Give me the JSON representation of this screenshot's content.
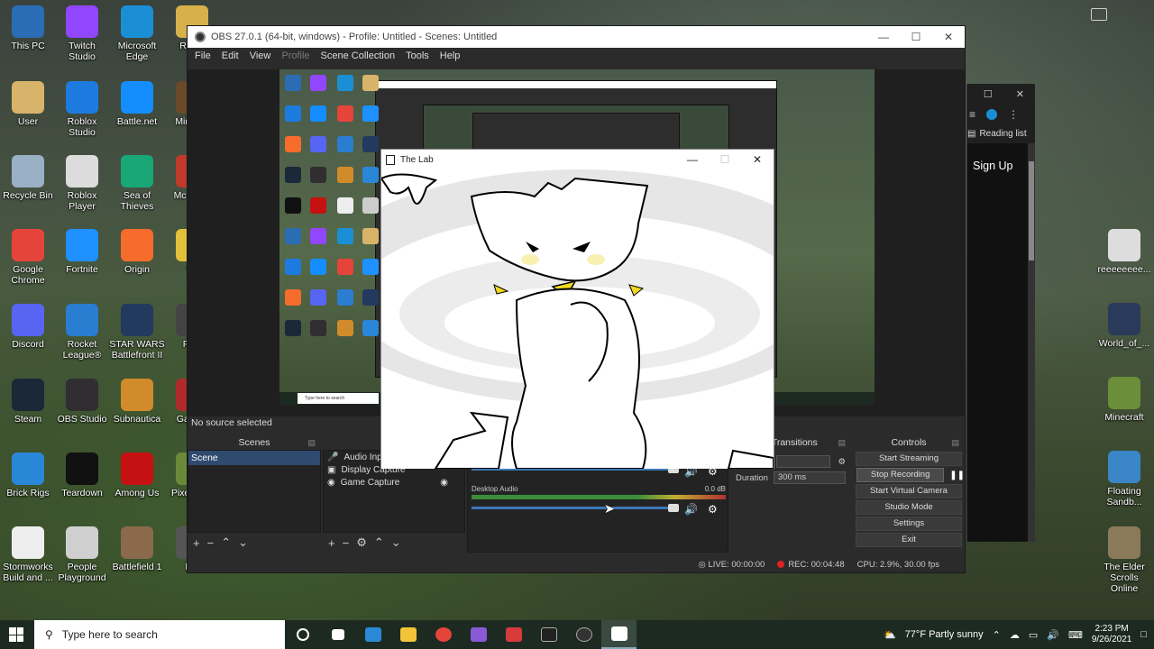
{
  "desktop_icons": [
    {
      "label": "This PC",
      "color": "#2a6db5"
    },
    {
      "label": "Twitch Studio",
      "color": "#9146ff"
    },
    {
      "label": "Microsoft Edge",
      "color": "#1b8fd6"
    },
    {
      "label": "REAL",
      "color": "#d6b04a"
    },
    {
      "label": "User",
      "color": "#d8b36a"
    },
    {
      "label": "Roblox Studio",
      "color": "#1d7be0"
    },
    {
      "label": "Battle.net",
      "color": "#148eff"
    },
    {
      "label": "Min Lau",
      "color": "#6b4a2b"
    },
    {
      "label": "Recycle Bin",
      "color": "#9ab0c4"
    },
    {
      "label": "Roblox Player",
      "color": "#dcdcdc"
    },
    {
      "label": "Sea of Thieves",
      "color": "#1aa777"
    },
    {
      "label": "Mc Secu",
      "color": "#c0392b"
    },
    {
      "label": "Google Chrome",
      "color": "#e5443a"
    },
    {
      "label": "Fortnite",
      "color": "#1e90ff"
    },
    {
      "label": "Origin",
      "color": "#f56c2d"
    },
    {
      "label": "Wi",
      "color": "#e1c03a"
    },
    {
      "label": "Discord",
      "color": "#5865f2"
    },
    {
      "label": "Rocket League®",
      "color": "#2a7dd1"
    },
    {
      "label": "STAR WARS Battlefront II",
      "color": "#223a5e"
    },
    {
      "label": "Play",
      "color": "#444444"
    },
    {
      "label": "Steam",
      "color": "#1b2838"
    },
    {
      "label": "OBS Studio",
      "color": "#302e31"
    },
    {
      "label": "Subnautica",
      "color": "#d18b2a"
    },
    {
      "label": "Gamea",
      "color": "#b02a2a"
    },
    {
      "label": "Brick Rigs",
      "color": "#2a86d6"
    },
    {
      "label": "Teardown",
      "color": "#111111"
    },
    {
      "label": "Among Us",
      "color": "#c51111"
    },
    {
      "label": "Pixel FPS",
      "color": "#6a8a3a"
    },
    {
      "label": "Stormworks Build and ...",
      "color": "#eeeeee"
    },
    {
      "label": "People Playground",
      "color": "#cfcfcf"
    },
    {
      "label": "Battlefield 1",
      "color": "#8a6a4a"
    },
    {
      "label": "Enl",
      "color": "#555555"
    },
    {
      "label": "reeeeeeee...",
      "color": "#dddddd"
    },
    {
      "label": "World_of_...",
      "color": "#2a3a5a"
    },
    {
      "label": "Minecraft",
      "color": "#6b8e3a"
    },
    {
      "label": "Floating Sandb...",
      "color": "#3a86c6"
    },
    {
      "label": "The Elder Scrolls Online",
      "color": "#8a7a5a"
    }
  ],
  "obs": {
    "title": "OBS 27.0.1 (64-bit, windows) - Profile: Untitled - Scenes: Untitled",
    "menu": [
      "File",
      "Edit",
      "View",
      "Profile",
      "Scene Collection",
      "Tools",
      "Help"
    ],
    "source_status": "No source selected",
    "scenes": {
      "header": "Scenes",
      "items": [
        "Scene"
      ]
    },
    "sources": {
      "header": "So",
      "items": [
        "Audio Input",
        "Display Capture",
        "Game Capture"
      ]
    },
    "mixer": {
      "desktop_audio_label": "Desktop Audio",
      "desktop_audio_db": "0.0 dB",
      "ticks": [
        "-60",
        "-55",
        "-50",
        "-45",
        "-40",
        "-35",
        "-30",
        "-25",
        "-20",
        "-15",
        "-10",
        "-5",
        "0"
      ]
    },
    "transitions": {
      "header": "e Transitions",
      "duration_label": "Duration",
      "duration_value": "300 ms"
    },
    "controls": {
      "header": "Controls",
      "buttons": [
        "Start Streaming",
        "Stop Recording",
        "Start Virtual Camera",
        "Studio Mode",
        "Settings",
        "Exit"
      ]
    },
    "status": {
      "live": "LIVE: 00:00:00",
      "rec": "REC: 00:04:48",
      "cpu": "CPU: 2.9%, 30.00 fps"
    }
  },
  "lab_window": {
    "title": "The Lab"
  },
  "browser": {
    "reading_list": "Reading list",
    "sign_up": "Sign Up"
  },
  "taskbar": {
    "search_placeholder": "Type here to search",
    "weather": "77°F  Partly sunny",
    "time": "2:23 PM",
    "date": "9/26/2021"
  },
  "nested_preview": {
    "search_placeholder": "Type here to search"
  }
}
